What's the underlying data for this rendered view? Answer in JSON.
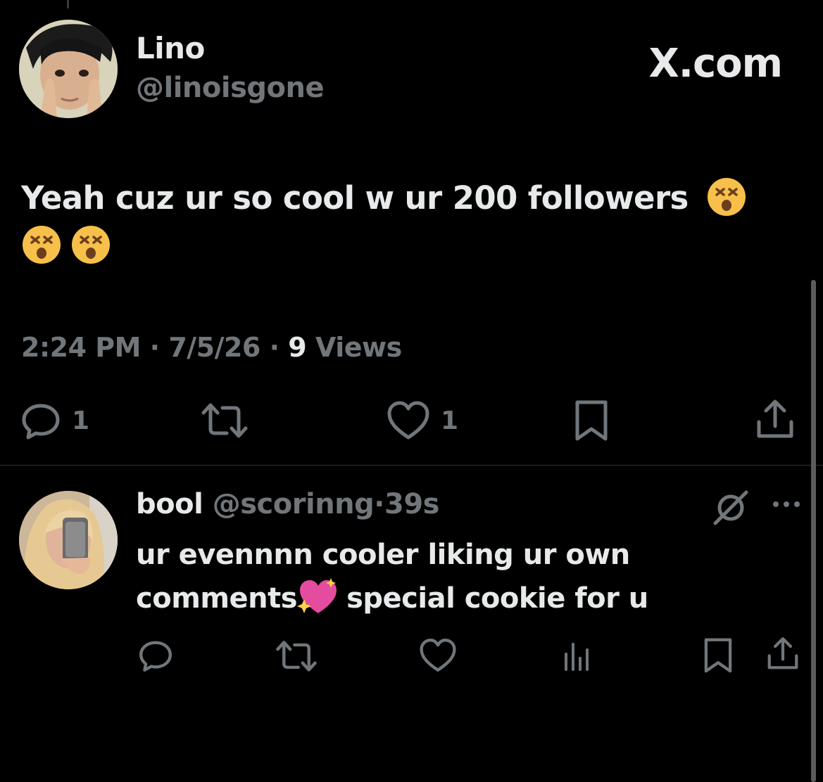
{
  "tweet": {
    "author_name": "Lino",
    "author_handle": "@linoisgone",
    "brand": "X.com",
    "text": "Yeah cuz ur so cool w ur 200 followers",
    "emojis": [
      "dizzy-face-emoji",
      "dizzy-face-emoji",
      "dizzy-face-emoji"
    ],
    "time": "2:24 PM",
    "sep1": " · ",
    "date": "7/5/26",
    "sep2": " · ",
    "views_count": "9",
    "views_label": " Views",
    "actions": {
      "reply_count": "1",
      "repost_count": "",
      "like_count": "1"
    }
  },
  "reply": {
    "name": "bool",
    "handle": "@scorinng",
    "dot": "·",
    "time": "39s",
    "line1": "ur evennnn cooler liking ur own",
    "line2_a": "comments",
    "line2_b": "special cookie for u",
    "emoji": "sparkling-heart-emoji"
  },
  "colors": {
    "background": "#000000",
    "primary_text": "#e7e9ea",
    "secondary_text": "#71767b",
    "divider": "#2f3336"
  }
}
